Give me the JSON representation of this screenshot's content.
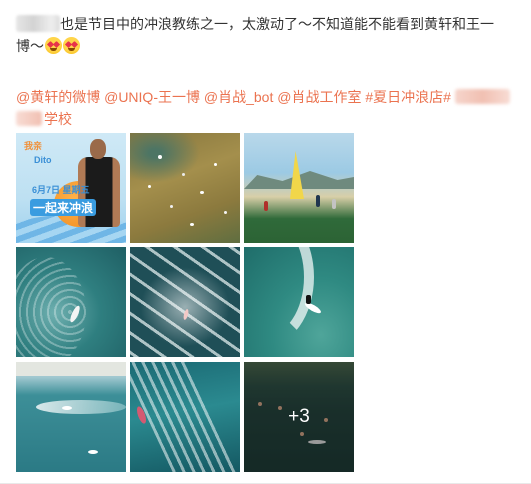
{
  "post": {
    "text_line1": "也是节目中的冲浪教练之一，太激动了～不知道能不能看到黄轩和王一",
    "text_line2": "博～",
    "tags": [
      "@黄轩的微博",
      "@UNIQ-王一博",
      "@肖战_bot",
      "@肖战工作室",
      "#夏日冲浪店#"
    ],
    "tag_tail": "学校"
  },
  "gallery": {
    "poster": {
      "line1": "我亲",
      "line2": "Dito",
      "line3": "6月7日 星期五",
      "line4": "一起来冲浪"
    },
    "more_count": "+3"
  },
  "colors": {
    "link": "#eb7350",
    "text": "#333333"
  },
  "icons": [
    "heart-eyes-emoji-icon"
  ]
}
